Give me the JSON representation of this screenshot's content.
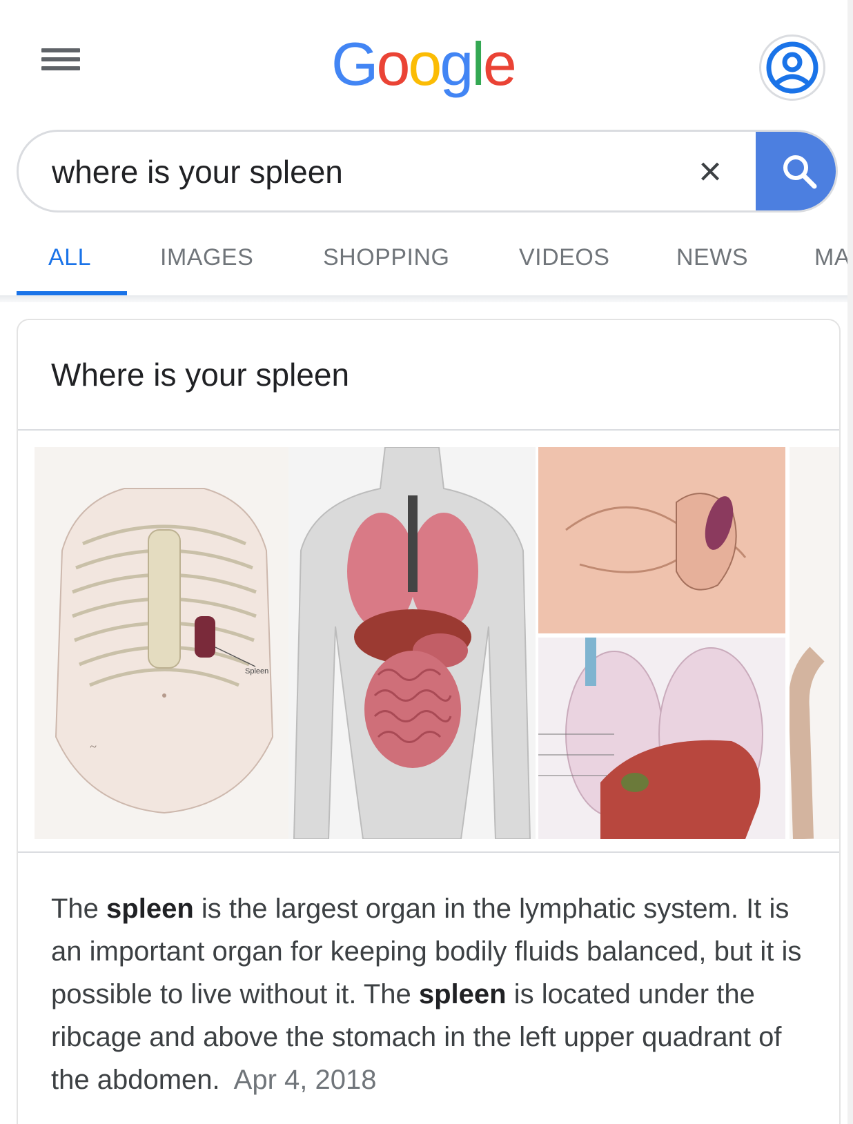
{
  "header": {
    "logo_letters": [
      "G",
      "o",
      "o",
      "g",
      "l",
      "e"
    ],
    "menu_icon": "hamburger-menu-icon",
    "account_icon": "account-circle-icon"
  },
  "search": {
    "query": "where is your spleen",
    "clear_label": "×",
    "search_icon": "search-icon"
  },
  "tabs": [
    {
      "label": "ALL",
      "active": true
    },
    {
      "label": "IMAGES",
      "active": false
    },
    {
      "label": "SHOPPING",
      "active": false
    },
    {
      "label": "VIDEOS",
      "active": false
    },
    {
      "label": "NEWS",
      "active": false
    },
    {
      "label": "MA",
      "active": false
    }
  ],
  "card": {
    "title": "Where is your spleen",
    "images": [
      {
        "label": "Spleen"
      },
      {
        "label": ""
      },
      {
        "label": ""
      },
      {
        "label": ""
      },
      {
        "label": ""
      }
    ],
    "snippet": {
      "part1": "The ",
      "bold1": "spleen",
      "part2": " is the largest organ in the lymphatic system. It is an important organ for keeping bodily fluids balanced, but it is possible to live without it. The ",
      "bold2": "spleen",
      "part3": " is located under the ribcage and above the stomach in the left upper quadrant of the abdomen.",
      "date": "Apr 4, 2018"
    }
  },
  "colors": {
    "accent": "#1a73e8",
    "search_button": "#4c7fe0",
    "tab_inactive": "#70757a"
  }
}
